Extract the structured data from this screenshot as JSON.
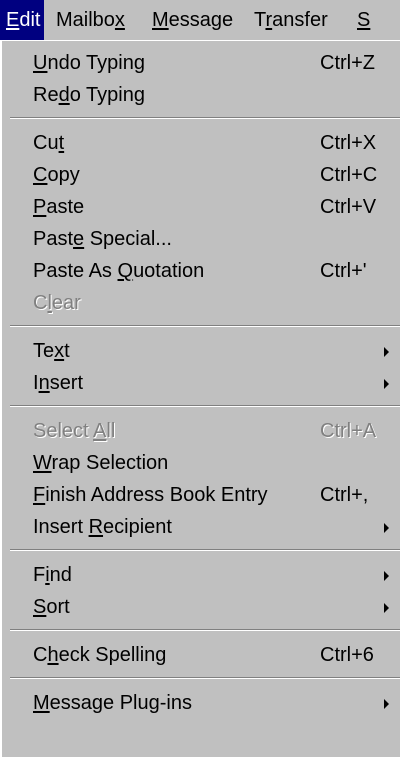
{
  "menubar": {
    "items": [
      {
        "label": "Edit",
        "accel": "E"
      },
      {
        "label": "Mailbox",
        "accel": "x"
      },
      {
        "label": "Message",
        "accel": "M"
      },
      {
        "label": "Transfer",
        "accel": "r"
      },
      {
        "label": "S",
        "accel": "S"
      }
    ]
  },
  "menu": {
    "groups": [
      [
        {
          "label": "Undo Typing",
          "accel": "U",
          "shortcut": "Ctrl+Z",
          "disabled": false,
          "submenu": false
        },
        {
          "label": "Redo Typing",
          "accel": "d",
          "shortcut": "",
          "disabled": false,
          "submenu": false
        }
      ],
      [
        {
          "label": "Cut",
          "accel": "t",
          "shortcut": "Ctrl+X",
          "disabled": false,
          "submenu": false
        },
        {
          "label": "Copy",
          "accel": "C",
          "shortcut": "Ctrl+C",
          "disabled": false,
          "submenu": false
        },
        {
          "label": "Paste",
          "accel": "P",
          "shortcut": "Ctrl+V",
          "disabled": false,
          "submenu": false
        },
        {
          "label": "Paste Special...",
          "accel": "e",
          "shortcut": "",
          "disabled": false,
          "submenu": false
        },
        {
          "label": "Paste As Quotation",
          "accel": "Q",
          "shortcut": "Ctrl+'",
          "disabled": false,
          "submenu": false
        },
        {
          "label": "Clear",
          "accel": "l",
          "shortcut": "",
          "disabled": true,
          "submenu": false
        }
      ],
      [
        {
          "label": "Text",
          "accel": "x",
          "shortcut": "",
          "disabled": false,
          "submenu": true
        },
        {
          "label": "Insert",
          "accel": "n",
          "shortcut": "",
          "disabled": false,
          "submenu": true
        }
      ],
      [
        {
          "label": "Select All",
          "accel": "A",
          "shortcut": "Ctrl+A",
          "disabled": true,
          "submenu": false
        },
        {
          "label": "Wrap Selection",
          "accel": "W",
          "shortcut": "",
          "disabled": false,
          "submenu": false
        },
        {
          "label": "Finish Address Book Entry",
          "accel": "F",
          "shortcut": "Ctrl+,",
          "disabled": false,
          "submenu": false
        },
        {
          "label": "Insert Recipient",
          "accel": "R",
          "shortcut": "",
          "disabled": false,
          "submenu": true
        }
      ],
      [
        {
          "label": "Find",
          "accel": "i",
          "shortcut": "",
          "disabled": false,
          "submenu": true
        },
        {
          "label": "Sort",
          "accel": "S",
          "shortcut": "",
          "disabled": false,
          "submenu": true
        }
      ],
      [
        {
          "label": "Check Spelling",
          "accel": "h",
          "shortcut": "Ctrl+6",
          "disabled": false,
          "submenu": false
        }
      ],
      [
        {
          "label": "Message Plug-ins",
          "accel": "M",
          "shortcut": "",
          "disabled": false,
          "submenu": true
        }
      ]
    ]
  },
  "colors": {
    "menu_bg": "#c0c0c0",
    "highlight_bg": "#000080",
    "highlight_fg": "#ffffff",
    "disabled_fg": "#808080"
  }
}
